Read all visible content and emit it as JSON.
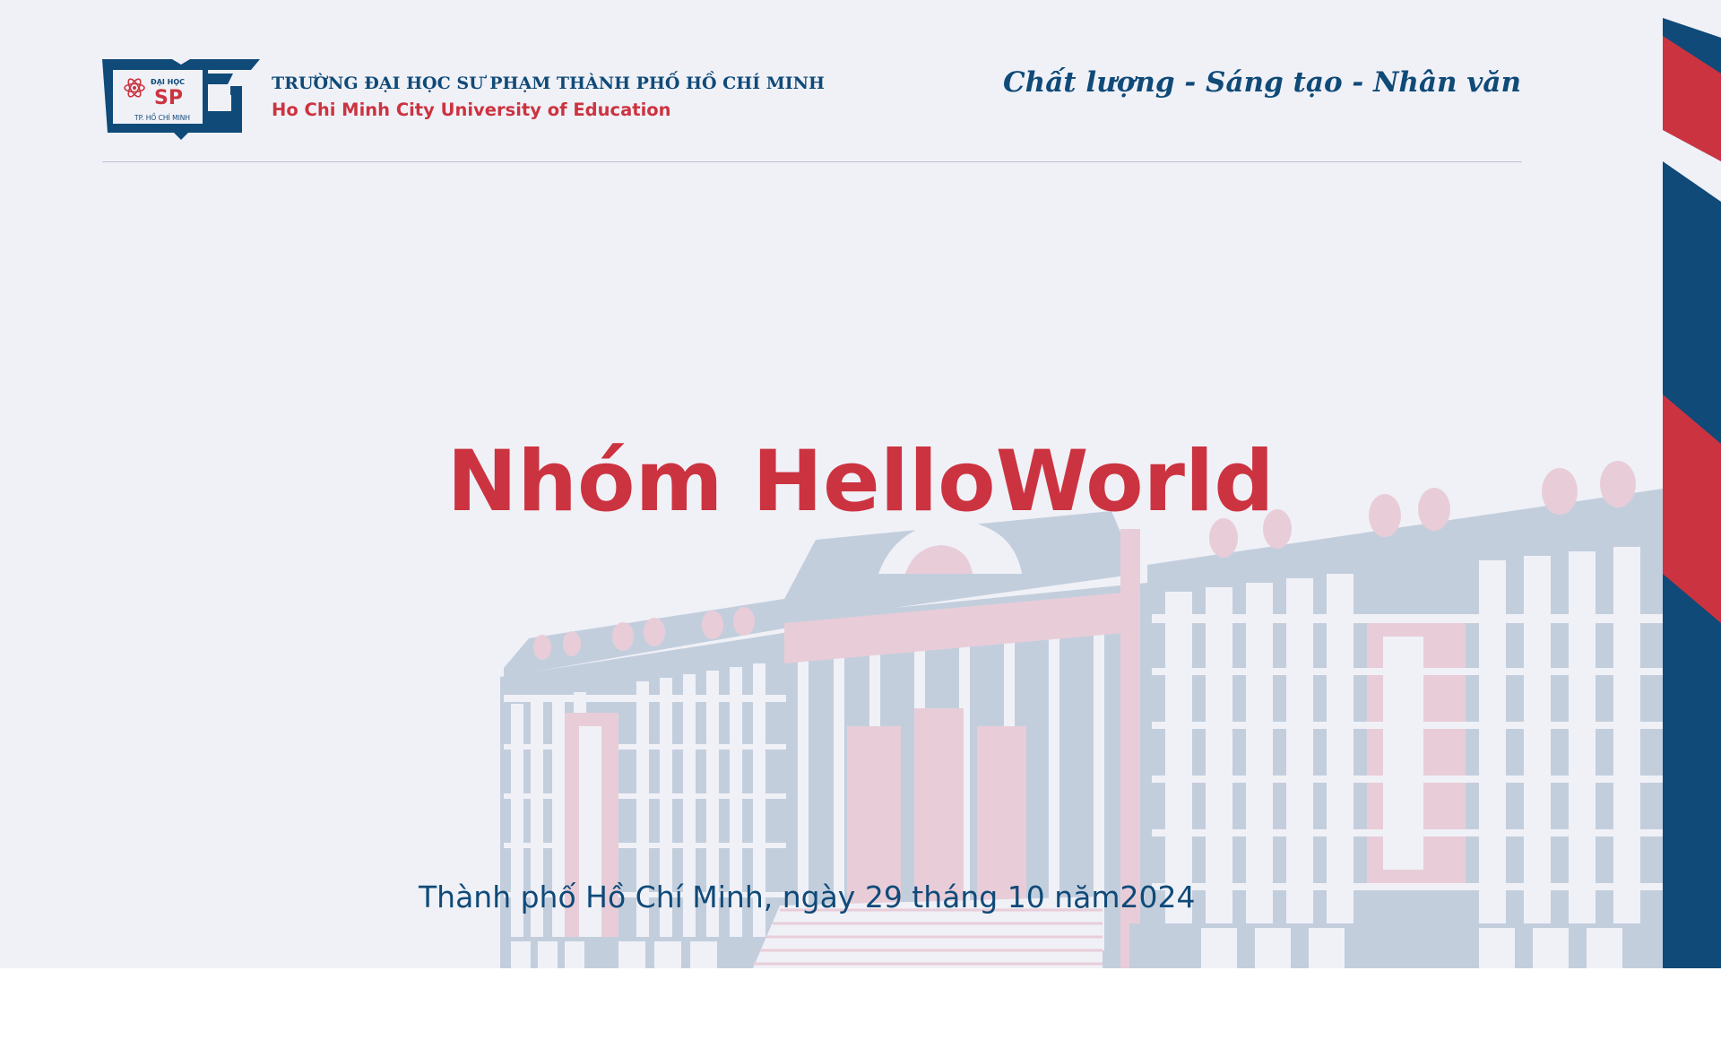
{
  "header": {
    "logo": {
      "small_text": "ĐẠI HỌC",
      "abbr": "SP",
      "city_text": "TP. HỒ CHÍ MINH",
      "icon": "atom-book-logo"
    },
    "university_name_vi": "TRƯỜNG ĐẠI HỌC SƯ PHẠM THÀNH PHỐ HỒ CHÍ MINH",
    "university_name_en": "Ho Chi Minh City University of Education",
    "motto": "Chất lượng - Sáng tạo - Nhân văn"
  },
  "main": {
    "title": "Nhóm HelloWorld",
    "date_line": "Thành phố Hồ Chí Minh, ngày 29 tháng 10 năm2024"
  },
  "colors": {
    "brand_blue": "#0f4a78",
    "brand_red": "#cc3340",
    "background": "#f0f1f7",
    "building_blue": "#c3cedd",
    "building_pink": "#e8cdd8"
  }
}
